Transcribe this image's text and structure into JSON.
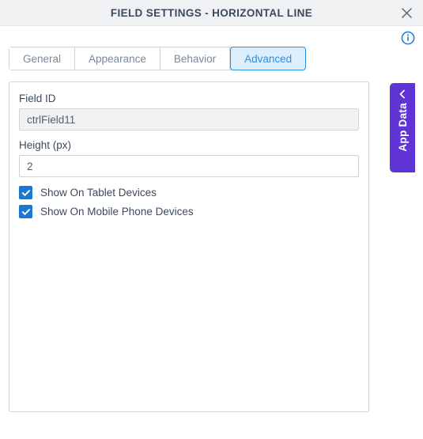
{
  "window": {
    "title": "FIELD SETTINGS - HORIZONTAL LINE",
    "close_icon": "close-icon",
    "info_icon": "info-icon",
    "accent_blue": "#2a8fe0",
    "checkbox_blue": "#1a78d2",
    "app_data_purple": "#6034d4",
    "titlebar_bg": "#f0f1f3",
    "title_color": "#3d4a5c"
  },
  "tabs": [
    {
      "label": "General",
      "active": false
    },
    {
      "label": "Appearance",
      "active": false
    },
    {
      "label": "Behavior",
      "active": false
    },
    {
      "label": "Advanced",
      "active": true
    }
  ],
  "form": {
    "field_id": {
      "label": "Field ID",
      "value": "ctrlField11",
      "placeholder": "",
      "readonly": true
    },
    "height": {
      "label": "Height (px)",
      "value": "2",
      "placeholder": "",
      "readonly": false
    },
    "checkboxes": [
      {
        "label": "Show On Tablet Devices",
        "checked": true
      },
      {
        "label": "Show On Mobile Phone Devices",
        "checked": true
      }
    ]
  },
  "app_data_panel": {
    "label": "App Data",
    "chevron_icon": "chevron-left-icon"
  }
}
